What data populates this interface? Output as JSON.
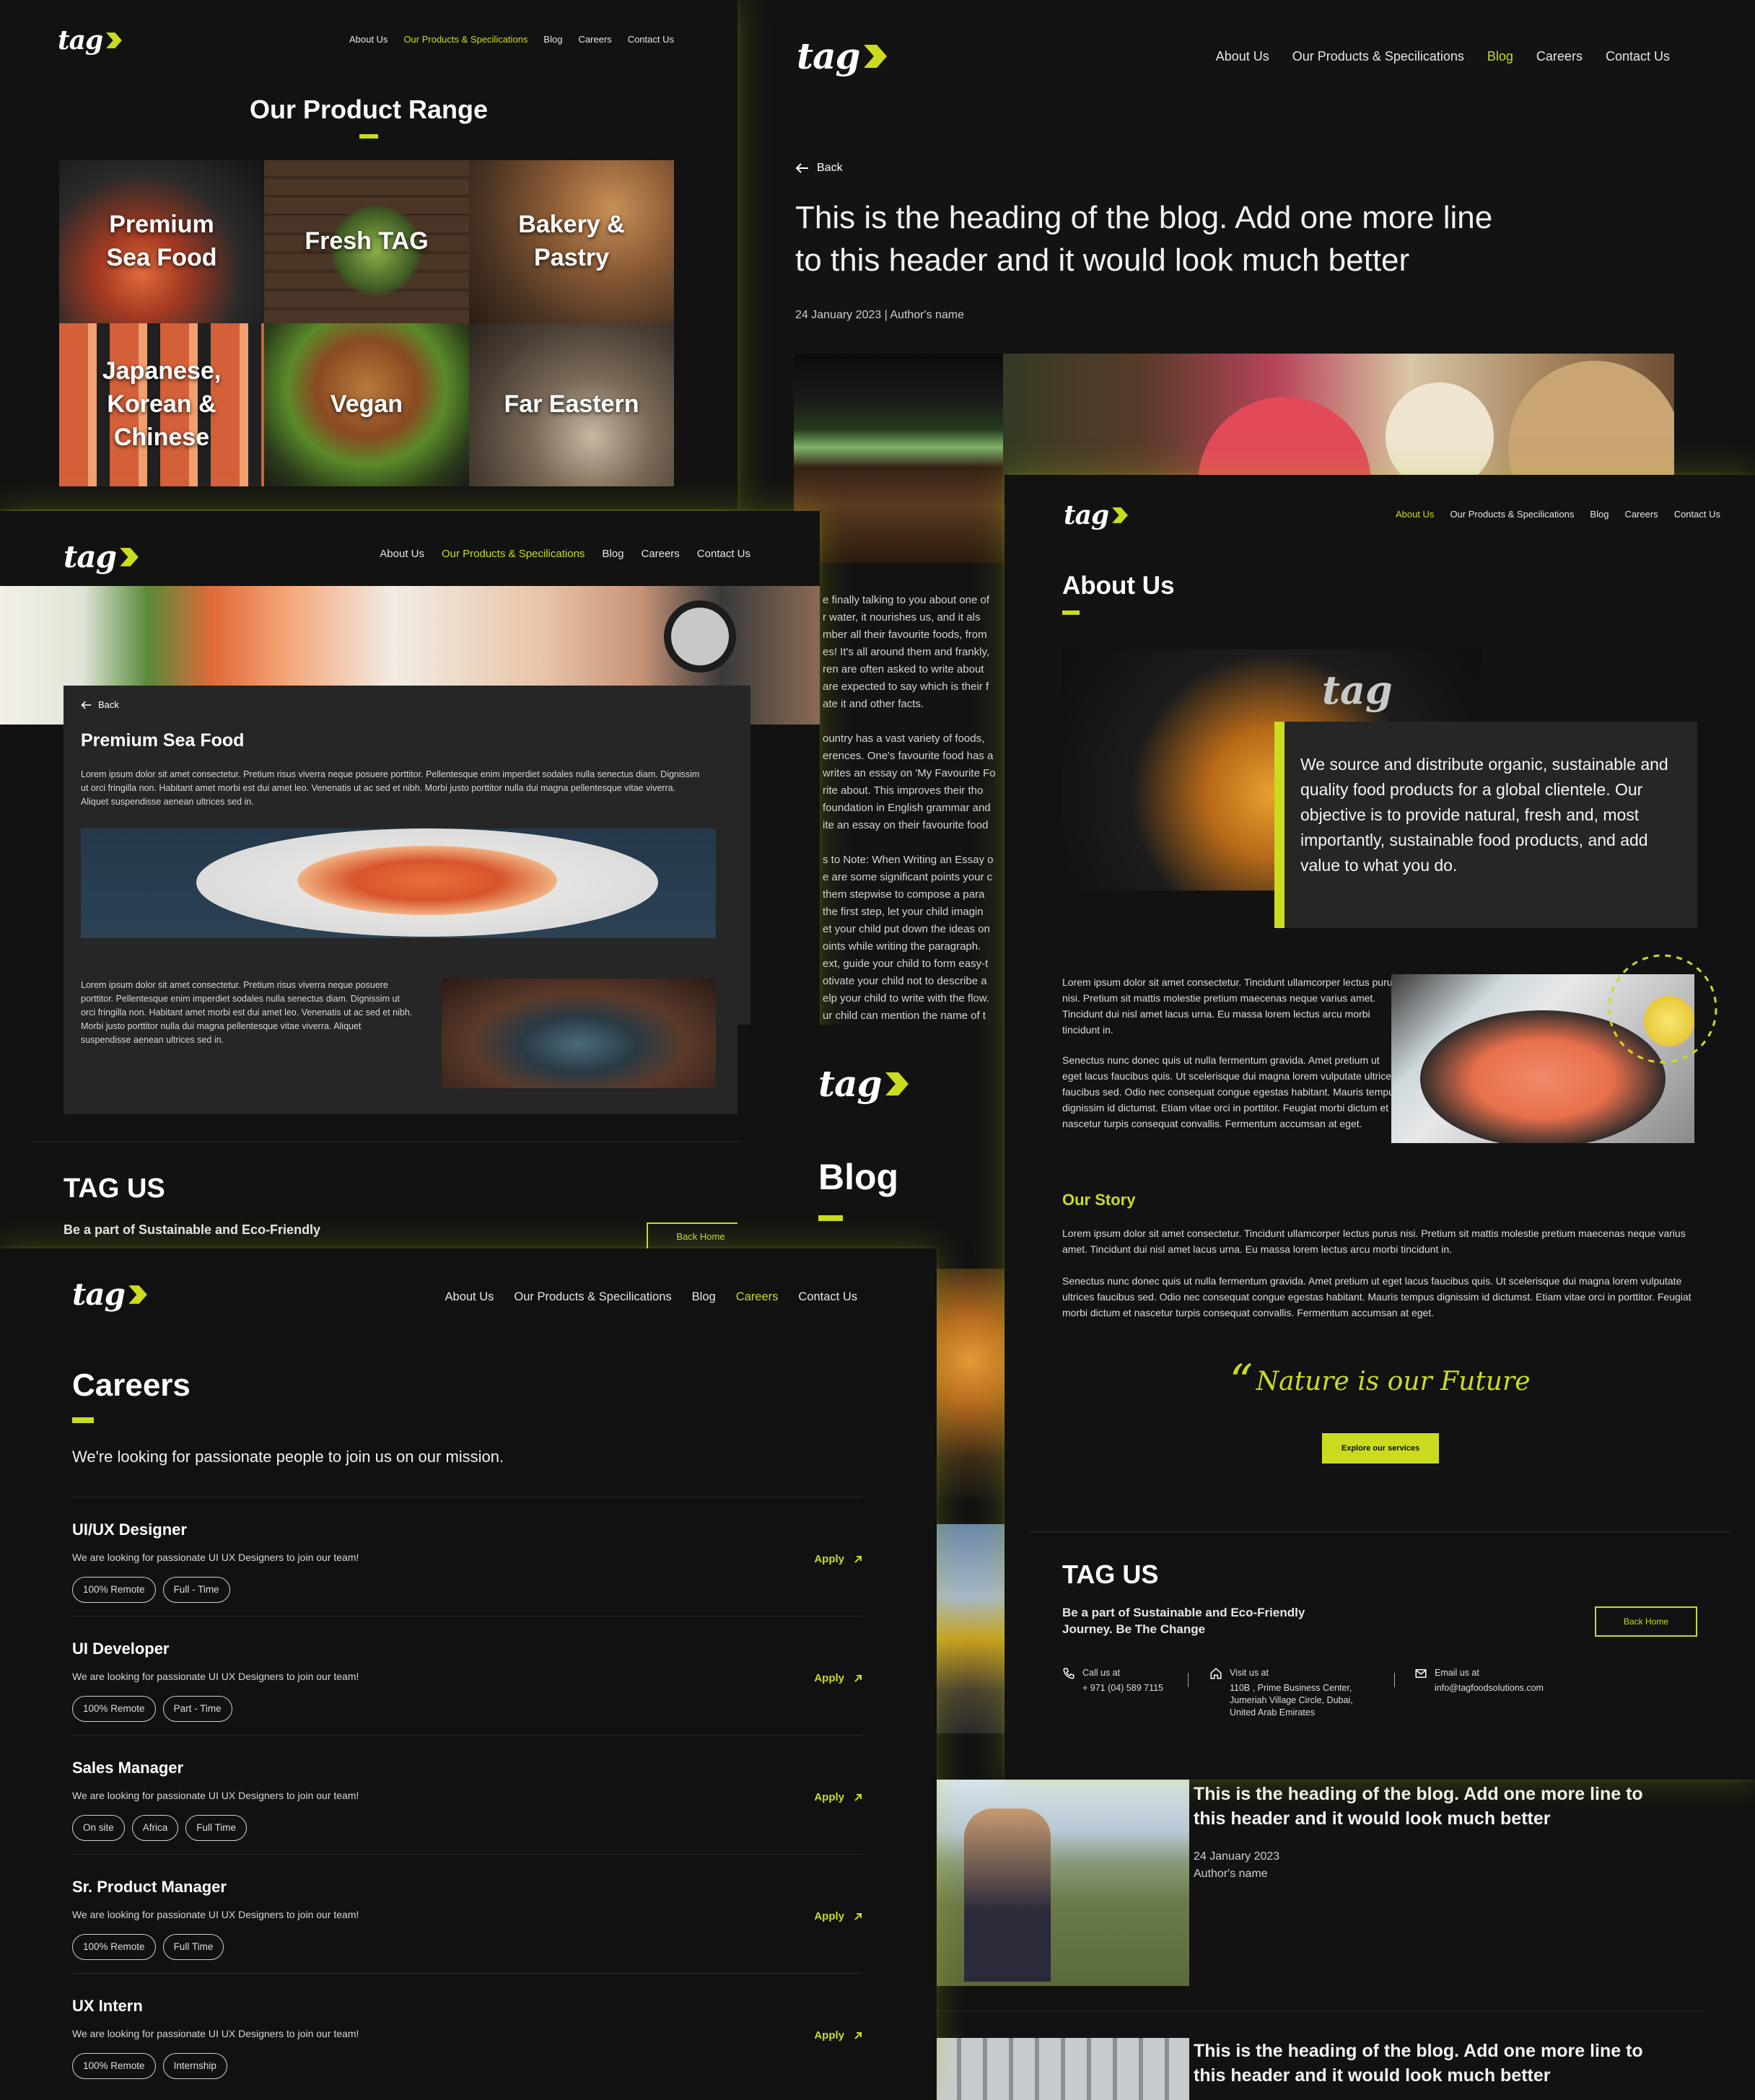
{
  "brand": {
    "logo_text": "tag"
  },
  "nav": {
    "about": "About Us",
    "products": "Our Products & Specilications",
    "blog": "Blog",
    "careers": "Careers",
    "contact": "Contact Us"
  },
  "product_range": {
    "title": "Our Product Range",
    "tiles": [
      {
        "label": "Premium Sea Food"
      },
      {
        "label": "Fresh TAG"
      },
      {
        "label": "Bakery & Pastry"
      },
      {
        "label": "Japanese, Korean & Chinese"
      },
      {
        "label": "Vegan"
      },
      {
        "label": "Far Eastern"
      }
    ]
  },
  "blog_post": {
    "back": "Back",
    "heading_line1": "This is the heading of the blog. Add one more line",
    "heading_line2": "to this header and it would look much better",
    "meta": "24 January 2023 | Author's name",
    "body_lines": [
      "e finally talking to you about one of",
      "r water, it nourishes us, and it als",
      "mber all their favourite foods, from",
      "es! It's all around them and frankly,",
      "ren are often asked to write about",
      "are expected to say which is their f",
      "ate it and other facts.",
      "",
      "ountry has a vast variety of foods,",
      "erences. One's favourite food has a",
      "writes an essay on 'My Favourite Fo",
      "rite about. This improves their tho",
      "foundation in English grammar and",
      "ite an essay on their favourite food",
      "",
      "s to Note: When Writing an Essay o",
      "e are some significant points your c",
      "them stepwise to compose a para",
      "the first step, let your child imagin",
      "et your child put down the ideas on",
      "oints while writing the paragraph.",
      "ext, guide your child to form easy-t",
      "otivate your child not to describe a",
      "elp your child to write with the flow.",
      "ur child can mention the name of t"
    ]
  },
  "seafood": {
    "back": "Back",
    "title": "Premium Sea Food",
    "para1": "Lorem ipsum dolor sit amet consectetur. Pretium risus viverra neque posuere porttitor. Pellentesque enim imperdiet sodales nulla senectus diam. Dignissim ut orci fringilla non. Habitant amet morbi est dui amet leo. Venenatis ut ac sed et nibh. Morbi justo porttitor nulla dui magna pellentesque vitae viverra. Aliquet suspendisse aenean ultrices sed in.",
    "para2": "Lorem ipsum dolor sit amet consectetur. Pretium risus viverra neque posuere porttitor. Pellentesque enim imperdiet sodales nulla senectus diam. Dignissim ut orci fringilla non. Habitant amet morbi est dui amet leo. Venenatis ut ac sed et nibh. Morbi justo porttitor nulla dui magna pellentesque vitae viverra. Aliquet suspendisse aenean ultrices sed in.",
    "footer_title": "TAG US",
    "footer_line": "Be a part of Sustainable and Eco-Friendly",
    "footer_button": "Back Home"
  },
  "blog_list": {
    "title": "Blog"
  },
  "about": {
    "title": "About Us",
    "intro": "We source and distribute organic, sustainable and quality food products for a global clientele. Our objective is to provide natural, fresh and, most importantly, sustainable food products, and add value to what you do.",
    "para1": "Lorem ipsum dolor sit amet consectetur. Tincidunt ullamcorper lectus purus nisi. Pretium sit mattis molestie pretium maecenas neque varius amet. Tincidunt dui nisl amet lacus urna. Eu massa lorem lectus arcu morbi tincidunt in.",
    "para2": "Senectus nunc donec quis ut nulla fermentum gravida. Amet pretium ut eget lacus faucibus quis. Ut scelerisque dui magna lorem vulputate ultrices faucibus sed. Odio nec consequat congue egestas habitant. Mauris tempus dignissim id dictumst. Etiam vitae orci in porttitor. Feugiat morbi dictum et nascetur turpis consequat convallis. Fermentum accumsan at eget.",
    "story_title": "Our Story",
    "story_p1": "Lorem ipsum dolor sit amet consectetur. Tincidunt ullamcorper lectus purus nisi. Pretium sit mattis molestie pretium maecenas neque varius amet. Tincidunt dui nisl amet lacus urna. Eu massa lorem lectus arcu morbi tincidunt in.",
    "story_p2": "Senectus nunc donec quis ut nulla fermentum gravida. Amet pretium ut eget lacus faucibus quis. Ut scelerisque dui magna lorem vulputate ultrices faucibus sed. Odio nec consequat congue egestas habitant. Mauris tempus dignissim id dictumst. Etiam vitae orci in porttitor. Feugiat morbi dictum et nascetur turpis consequat convallis. Fermentum accumsan at eget.",
    "quote": "Nature is our Future",
    "cta": "Explore our services",
    "footer_title": "TAG US",
    "footer_line1": "Be a part of Sustainable and Eco-Friendly",
    "footer_line2": "Journey. Be The Change",
    "footer_button": "Back Home",
    "call_label": "Call us at",
    "call_value": "+ 971 (04) 589 7115",
    "visit_label": "Visit us at",
    "visit_l1": "110B , Prime Business Center,",
    "visit_l2": "Jumeriah Village Circle, Dubai,",
    "visit_l3": "United Arab Emirates",
    "email_label": "Email us at",
    "email_value": "info@tagfoodsolutions.com"
  },
  "blog_cards": [
    {
      "title_l1": "This is the heading of the blog. Add one more line to",
      "title_l2": "this header and it would look much better",
      "date": "24 January 2023",
      "author": "Author's name"
    },
    {
      "title_l1": "This is the heading of the blog. Add one more line to",
      "title_l2": "this header and it would look much better"
    }
  ],
  "careers": {
    "title": "Careers",
    "subtitle": "We're looking for passionate people to join us on our mission.",
    "apply": "Apply",
    "jobs": [
      {
        "title": "UI/UX Designer",
        "desc": "We are looking for passionate UI UX Designers to join our team!",
        "tags": [
          "100% Remote",
          "Full - Time"
        ]
      },
      {
        "title": "UI Developer",
        "desc": "We are looking for passionate UI UX Designers to join our team!",
        "tags": [
          "100% Remote",
          "Part - Time"
        ]
      },
      {
        "title": "Sales Manager",
        "desc": "We are looking for passionate UI UX Designers to join our team!",
        "tags": [
          "On site",
          "Africa",
          "Full Time"
        ]
      },
      {
        "title": "Sr. Product Manager",
        "desc": "We are looking for passionate UI UX Designers to join our team!",
        "tags": [
          "100% Remote",
          "Full Time"
        ]
      },
      {
        "title": "UX Intern",
        "desc": "We are looking for passionate UI UX Designers to join our team!",
        "tags": [
          "100% Remote",
          "Internship"
        ]
      }
    ]
  },
  "colors": {
    "accent": "#cbdc1e",
    "bg": "#121212",
    "card": "#262626"
  },
  "icons": [
    "arrow-left-icon",
    "arrow-up-right-icon",
    "phone-icon",
    "home-icon",
    "mail-icon",
    "quote-icon",
    "logo-chevron-icon"
  ]
}
